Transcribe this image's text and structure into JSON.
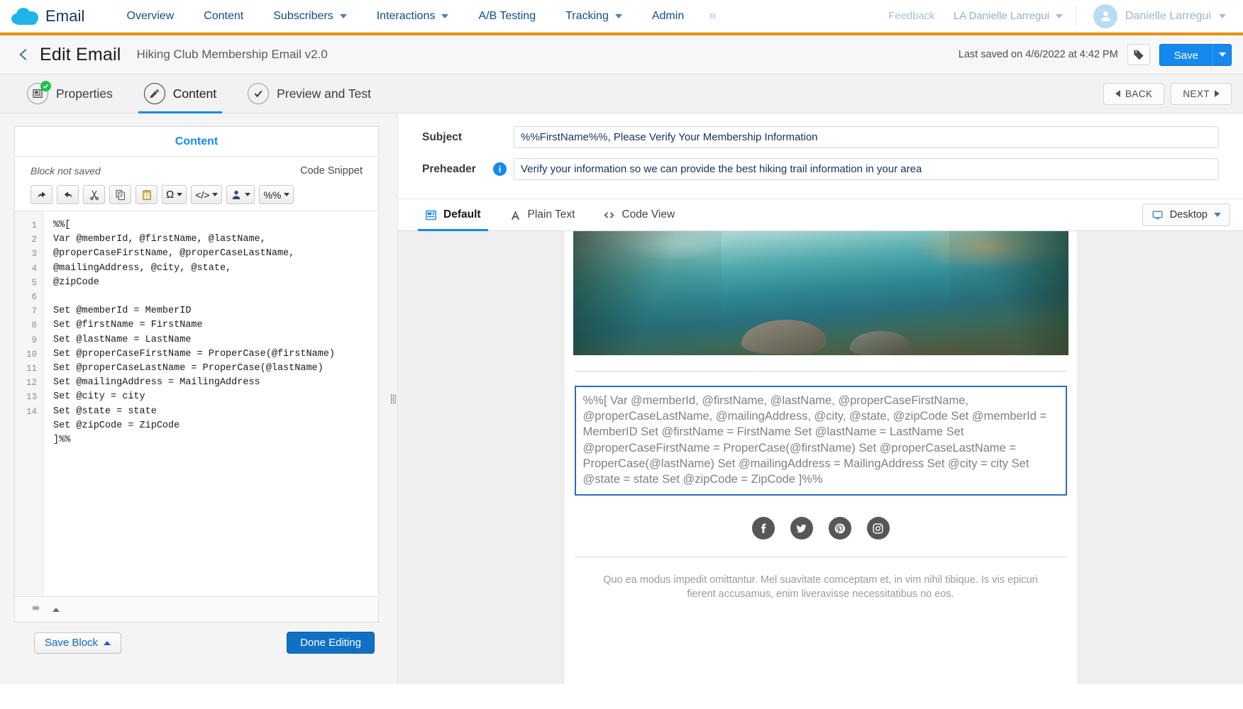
{
  "globalnav": {
    "app_name": "Email",
    "logo_icon": "salesforce-cloud-logo",
    "items": [
      {
        "label": "Overview",
        "has_caret": false
      },
      {
        "label": "Content",
        "has_caret": false
      },
      {
        "label": "Subscribers",
        "has_caret": true
      },
      {
        "label": "Interactions",
        "has_caret": true
      },
      {
        "label": "A/B Testing",
        "has_caret": false
      },
      {
        "label": "Tracking",
        "has_caret": true
      },
      {
        "label": "Admin",
        "has_caret": false
      }
    ],
    "more_icon": "»",
    "feedback": "Feedback",
    "account": "LA Danielle Larregui",
    "user": "Danielle Larregui",
    "avatar_icon": "user-avatar-icon"
  },
  "pageheader": {
    "back_icon": "back-chevron-icon",
    "title": "Edit Email",
    "subtitle": "Hiking Club Membership Email v2.0",
    "last_saved": "Last saved on 4/6/2022 at 4:42 PM",
    "tag_icon": "tag-icon",
    "save_label": "Save",
    "save_caret_icon": "chevron-down-icon",
    "accent_color": "#e8910c",
    "brand_blue": "#1589ee"
  },
  "steps": {
    "items": [
      {
        "label": "Properties",
        "icon": "properties-icon",
        "complete": true,
        "active": false
      },
      {
        "label": "Content",
        "icon": "pencil-icon",
        "complete": false,
        "active": true
      },
      {
        "label": "Preview and Test",
        "icon": "check-circle-icon",
        "complete": false,
        "active": false
      }
    ],
    "back_label": "BACK",
    "next_label": "NEXT"
  },
  "leftpanel": {
    "header": "Content",
    "block_status": "Block not saved",
    "code_snippet_label": "Code Snippet",
    "toolbar": [
      {
        "name": "undo-icon",
        "label": "",
        "caret": false
      },
      {
        "name": "redo-icon",
        "label": "",
        "caret": false
      },
      {
        "name": "cut-scissors-icon",
        "label": "",
        "caret": false
      },
      {
        "name": "copy-icon",
        "label": "",
        "caret": false
      },
      {
        "name": "paste-as-text-icon",
        "label": "",
        "caret": false
      },
      {
        "name": "special-character-icon",
        "label": "Ω",
        "caret": true
      },
      {
        "name": "source-code-icon",
        "label": "</>",
        "caret": true
      },
      {
        "name": "personalization-icon",
        "label": "",
        "caret": true
      },
      {
        "name": "ampscript-icon",
        "label": "%%",
        "caret": true
      }
    ],
    "code_line_numbers": [
      "1",
      "2",
      "",
      "",
      "3",
      "4",
      "5",
      "6",
      "7",
      "8",
      "9",
      "10",
      "11",
      "12",
      "13",
      "14"
    ],
    "code_lines": [
      "%%[",
      "Var @memberId, @firstName, @lastName,",
      "@properCaseFirstName, @properCaseLastName,",
      "@mailingAddress, @city, @state,",
      "@zipCode",
      "",
      "Set @memberId = MemberID",
      "Set @firstName = FirstName",
      "Set @lastName = LastName",
      "Set @properCaseFirstName = ProperCase(@firstName)",
      "Set @properCaseLastName = ProperCase(@lastName)",
      "Set @mailingAddress = MailingAddress",
      "Set @city = city",
      "Set @state = state",
      "Set @zipCode = ZipCode",
      "]%%"
    ],
    "gear_icon": "gear-icon",
    "collapse_icon": "caret-up-icon",
    "save_block_label": "Save Block",
    "done_editing_label": "Done Editing"
  },
  "splitter_icon": "resize-handle-icon",
  "rightpanel": {
    "subject_label": "Subject",
    "subject_value": "%%FirstName%%, Please Verify Your Membership Information",
    "preheader_label": "Preheader",
    "preheader_info_icon": "info-icon",
    "preheader_value": "Verify your information so we can provide the best hiking trail information in your area",
    "tabs": [
      {
        "label": "Default",
        "icon": "layout-icon",
        "active": true
      },
      {
        "label": "Plain Text",
        "icon": "text-a-icon",
        "active": false
      },
      {
        "label": "Code View",
        "icon": "code-view-icon",
        "active": false
      }
    ],
    "device_label": "Desktop",
    "device_icon": "desktop-monitor-icon",
    "device_caret_icon": "chevron-down-icon"
  },
  "emailpreview": {
    "hero_image_alt": "lake-shoreline-hero-image",
    "amp_block_text": "%%[ Var @memberId, @firstName, @lastName, @properCaseFirstName, @properCaseLastName, @mailingAddress, @city, @state, @zipCode Set @memberId = MemberID Set @firstName = FirstName Set @lastName = LastName Set @properCaseFirstName = ProperCase(@firstName) Set @properCaseLastName = ProperCase(@lastName) Set @mailingAddress = MailingAddress Set @city = city Set @state = state Set @zipCode = ZipCode ]%%",
    "socials": [
      "facebook-icon",
      "twitter-icon",
      "pinterest-icon",
      "instagram-icon"
    ],
    "footer_text": "Quo ea modus impedit omittantur. Mel suavitate comceptam et, in vim nihil tibique. Is vis epicuri fierent accusamus, enim liveravisse necessitatibus no eos."
  }
}
